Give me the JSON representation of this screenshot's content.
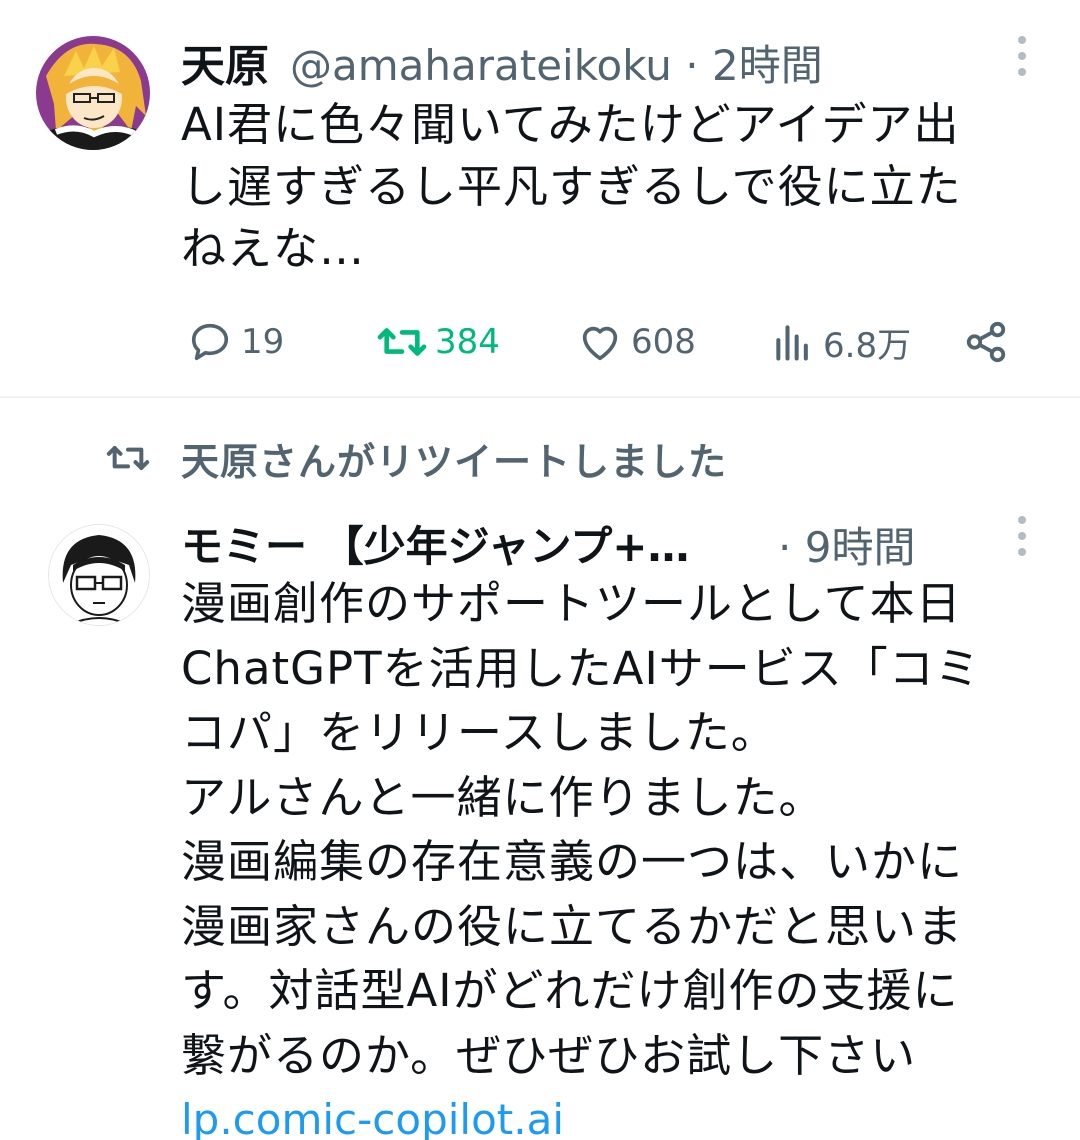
{
  "tweet1": {
    "display_name": "天原",
    "handle": "@amaharateikoku",
    "separator": "·",
    "time": "2時間",
    "text": "AI君に色々聞いてみたけどアイデア出\nし遅すぎるし平凡すぎるしで役に立た\nねえな…",
    "replies": "19",
    "retweets": "384",
    "likes": "608",
    "views": "6.8万"
  },
  "retweet_context": {
    "label": "天原さんがリツイートしました"
  },
  "tweet2": {
    "display_name": "モミー 【少年ジャンプ+…",
    "separator": "·",
    "time": "9時間",
    "text": "漫画創作のサポートツールとして本日\nChatGPTを活用したAIサービス「コミ\nコパ」をリリースしました。\nアルさんと一緒に作りました。\n漫画編集の存在意義の一つは、いかに\n漫画家さんの役に立てるかだと思いま\nす。対話型AIがどれだけ創作の支援に\n繋がるのか。ぜひぜひお試し下さい",
    "link_text": "lp.comic-copilot.ai"
  },
  "colors": {
    "text_primary": "#0f1419",
    "text_secondary": "#536471",
    "retweet_green": "#00ba7c",
    "link_blue": "#1d9bf0",
    "divider": "#eff3f4"
  },
  "icons": {
    "reply": "speech-bubble-icon",
    "retweet": "retweet-arrows-icon",
    "like": "heart-icon",
    "views": "bar-chart-icon",
    "share": "share-icon",
    "more": "vertical-ellipsis-icon"
  }
}
